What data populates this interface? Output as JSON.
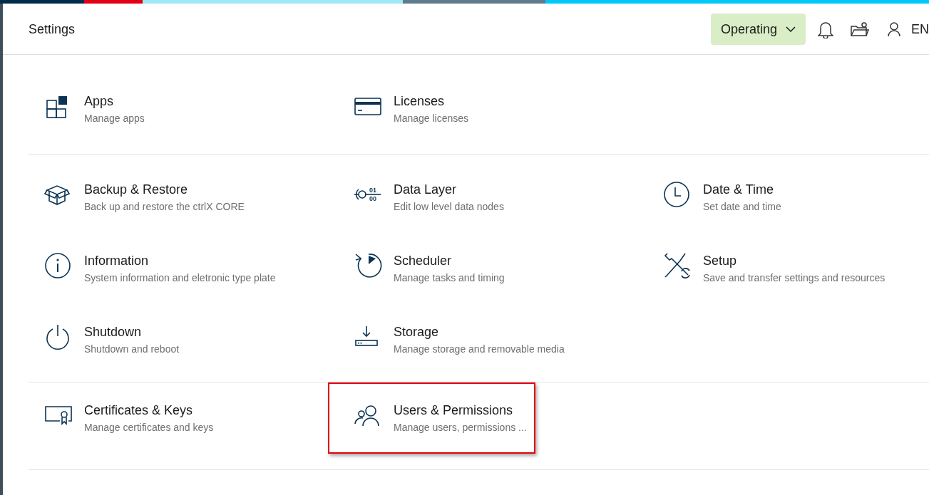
{
  "header": {
    "title": "Settings",
    "status": {
      "label": "Operating"
    },
    "language": "EN"
  },
  "sections": [
    {
      "items": [
        {
          "kind": "apps",
          "title": "Apps",
          "description": "Manage apps",
          "highlighted": false
        },
        {
          "kind": "licenses",
          "title": "Licenses",
          "description": "Manage licenses",
          "highlighted": false
        }
      ]
    },
    {
      "items": [
        {
          "kind": "backup",
          "title": "Backup & Restore",
          "description": "Back up and restore the ctrlX CORE",
          "highlighted": false
        },
        {
          "kind": "datalayer",
          "icon_labels": [
            "01",
            "00"
          ],
          "title": "Data Layer",
          "description": "Edit low level data nodes",
          "highlighted": false
        },
        {
          "kind": "clock",
          "title": "Date & Time",
          "description": "Set date and time",
          "highlighted": false
        },
        {
          "kind": "info",
          "title": "Information",
          "description": "System information and eletronic type plate",
          "highlighted": false
        },
        {
          "kind": "scheduler",
          "title": "Scheduler",
          "description": "Manage tasks and timing",
          "highlighted": false
        },
        {
          "kind": "setup",
          "title": "Setup",
          "description": "Save and transfer settings and resources",
          "highlighted": false
        },
        {
          "kind": "power",
          "title": "Shutdown",
          "description": "Shutdown and reboot",
          "highlighted": false
        },
        {
          "kind": "storage",
          "title": "Storage",
          "description": "Manage storage and removable media",
          "highlighted": false
        }
      ]
    },
    {
      "items": [
        {
          "kind": "certificate",
          "title": "Certificates & Keys",
          "description": "Manage certificates and keys",
          "highlighted": false
        },
        {
          "kind": "users",
          "title": "Users & Permissions",
          "description": "Manage users, permissions ...",
          "highlighted": true
        }
      ]
    }
  ]
}
